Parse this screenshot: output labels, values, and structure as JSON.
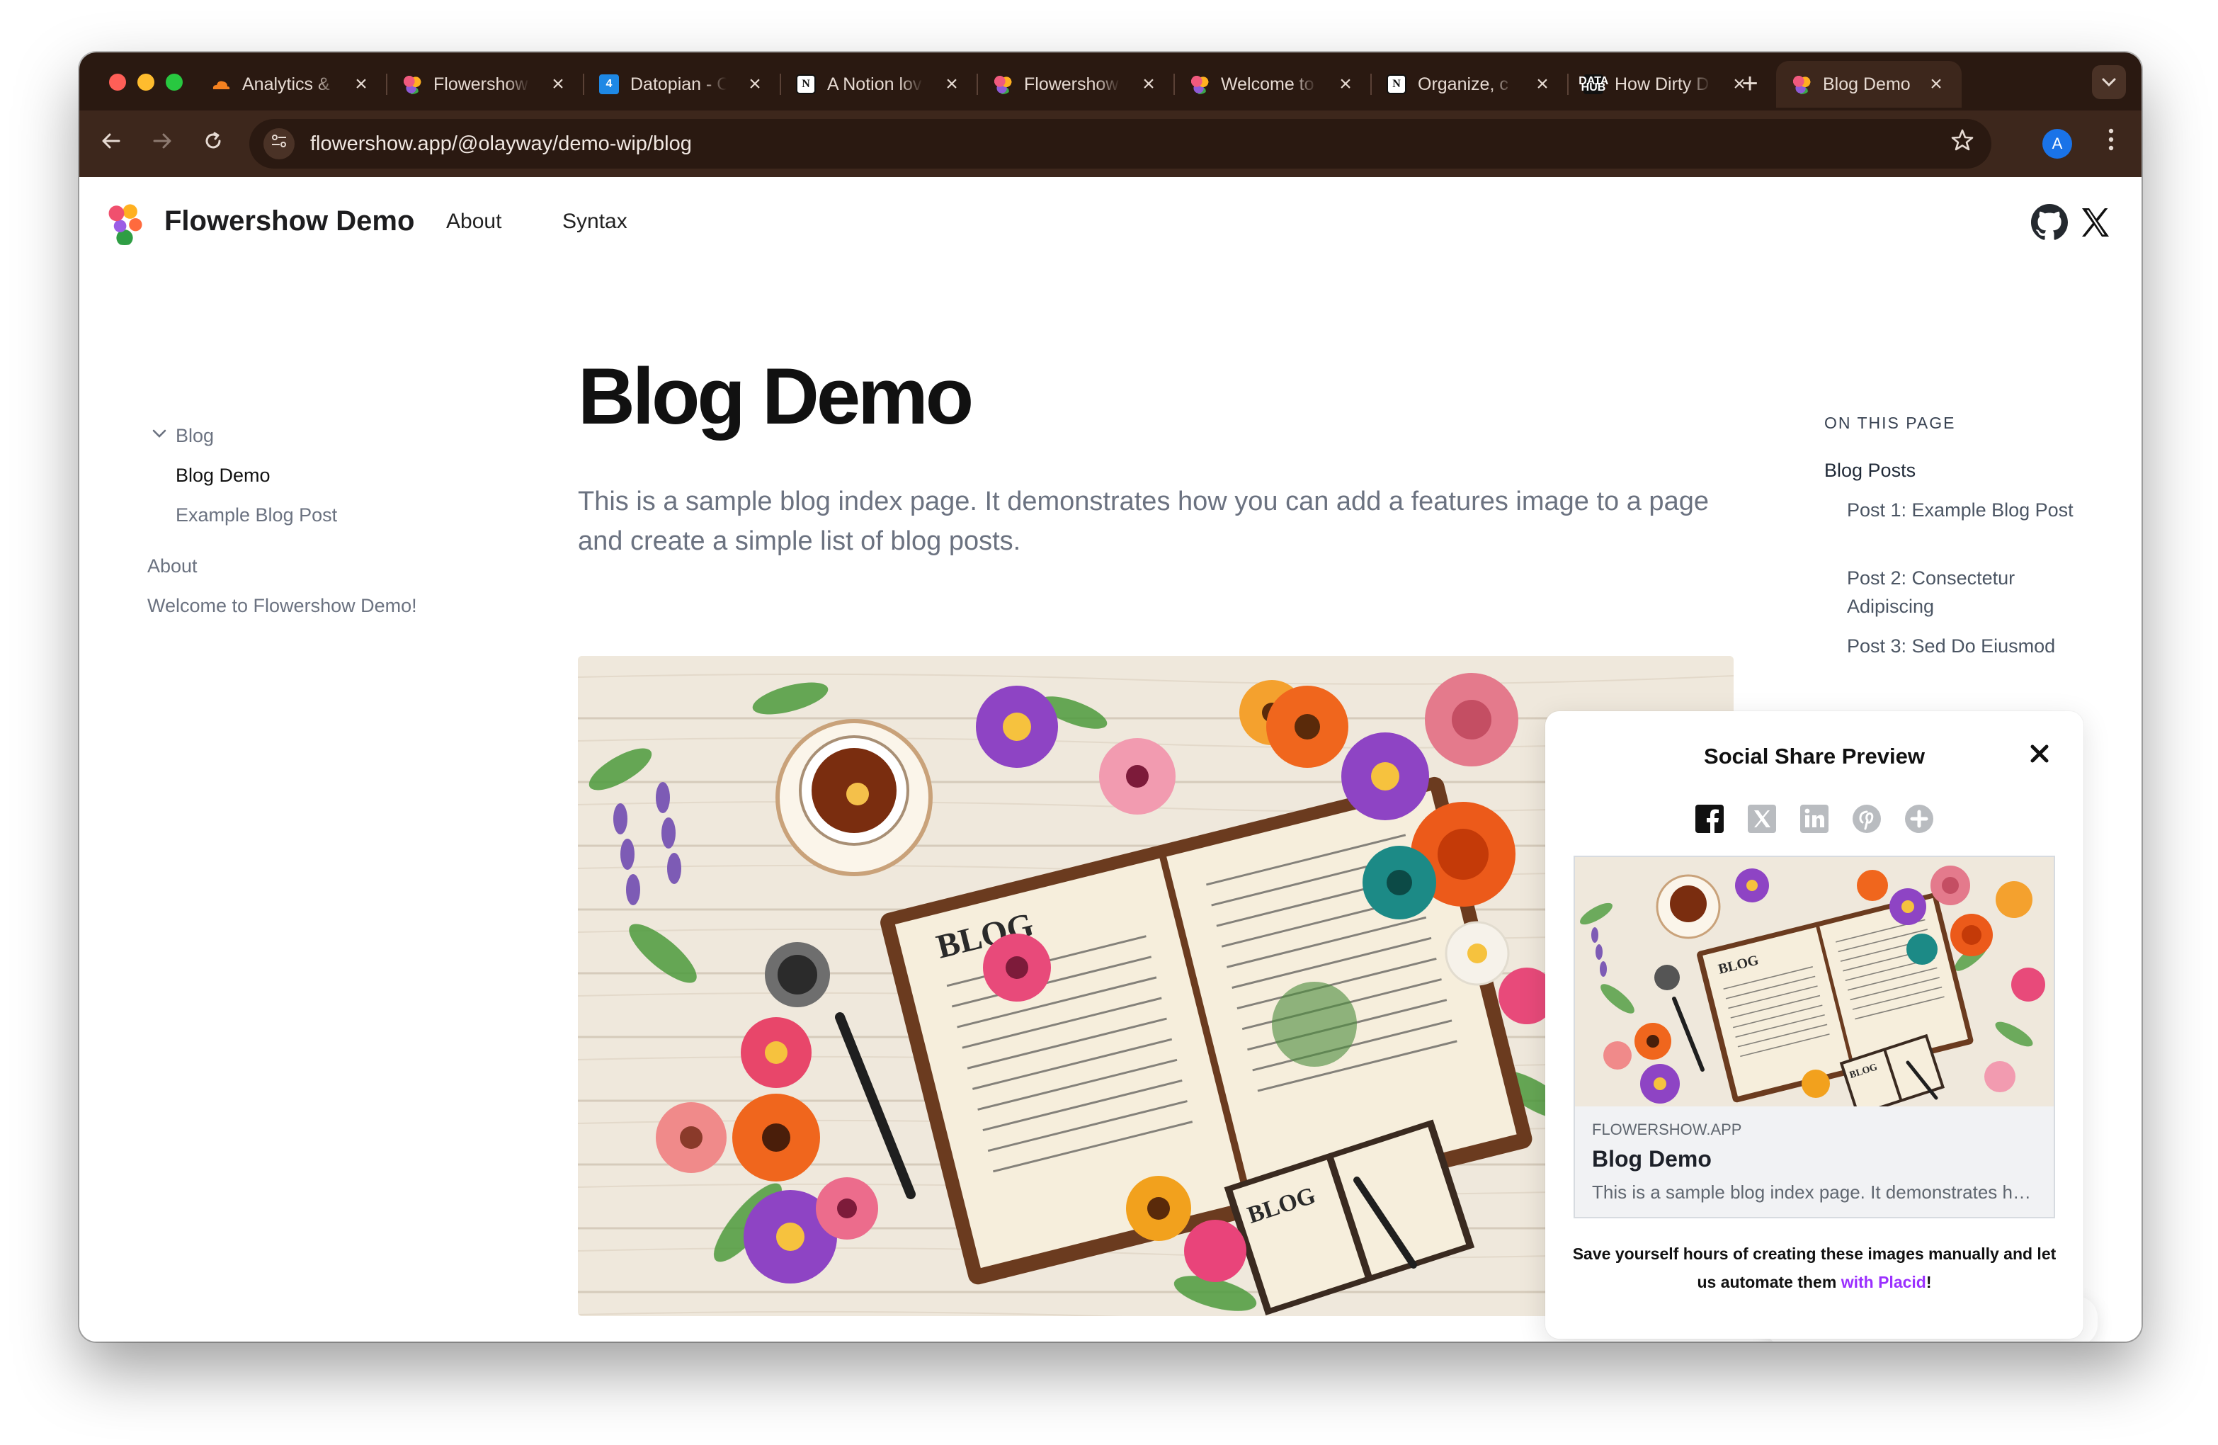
{
  "browser": {
    "tabs": [
      {
        "title": "Analytics &",
        "icon": "cloudflare-icon"
      },
      {
        "title": "Flowershow",
        "icon": "flowershow-icon"
      },
      {
        "title": "Datopian - C",
        "icon": "calendar-icon"
      },
      {
        "title": "A Notion lov",
        "icon": "notion-icon"
      },
      {
        "title": "Flowershow",
        "icon": "flowershow-icon"
      },
      {
        "title": "Welcome to",
        "icon": "flowershow-icon"
      },
      {
        "title": "Organize, c",
        "icon": "notion-icon"
      },
      {
        "title": "How Dirty D",
        "icon": "datahub-icon"
      },
      {
        "title": "Blog Demo",
        "icon": "flowershow-icon",
        "active": true
      }
    ],
    "calendar_badge": "4",
    "notion_letter": "N",
    "datahub_badge": "DATA HUB",
    "url": "flowershow.app/@olayway/demo-wip/blog",
    "avatar_letter": "A"
  },
  "site": {
    "title": "Flowershow Demo",
    "nav": [
      "About",
      "Syntax"
    ]
  },
  "sidebar": {
    "group": "Blog",
    "group_items": [
      "Blog Demo",
      "Example Blog Post"
    ],
    "items": [
      "About",
      "Welcome to Flowershow Demo!"
    ]
  },
  "main": {
    "title": "Blog Demo",
    "description": "This is a sample blog index page. It demonstrates how you can add a features image to a page and create a simple list of blog posts.",
    "hero_book_label": "BLOG",
    "hero_small_label": "BLOG"
  },
  "toc": {
    "heading": "ON THIS PAGE",
    "items": [
      "Blog Posts",
      "Post 1: Example Blog Post",
      "Post 2: Consectetur Adipiscing",
      "Post 3: Sed Do Eiusmod"
    ]
  },
  "share": {
    "title": "Social Share Preview",
    "icons": [
      "facebook-icon",
      "x-icon",
      "linkedin-icon",
      "pinterest-icon",
      "more-icon"
    ],
    "card": {
      "domain": "FLOWERSHOW.APP",
      "title": "Blog Demo",
      "description": "This is a sample blog index page. It demonstrates how you can add a features image to a page and create a simple list of blog posts.",
      "image_label": "BLOG",
      "image_small_label": "BLOG"
    },
    "footer_text": "Save yourself hours of creating these images manually and let us automate them ",
    "footer_link": "with Placid",
    "footer_end": "!"
  },
  "colors": {
    "tabstrip": "#2a1911",
    "toolbar": "#3d271c",
    "accent_link": "#9b30ff",
    "avatar": "#1a73e8"
  }
}
